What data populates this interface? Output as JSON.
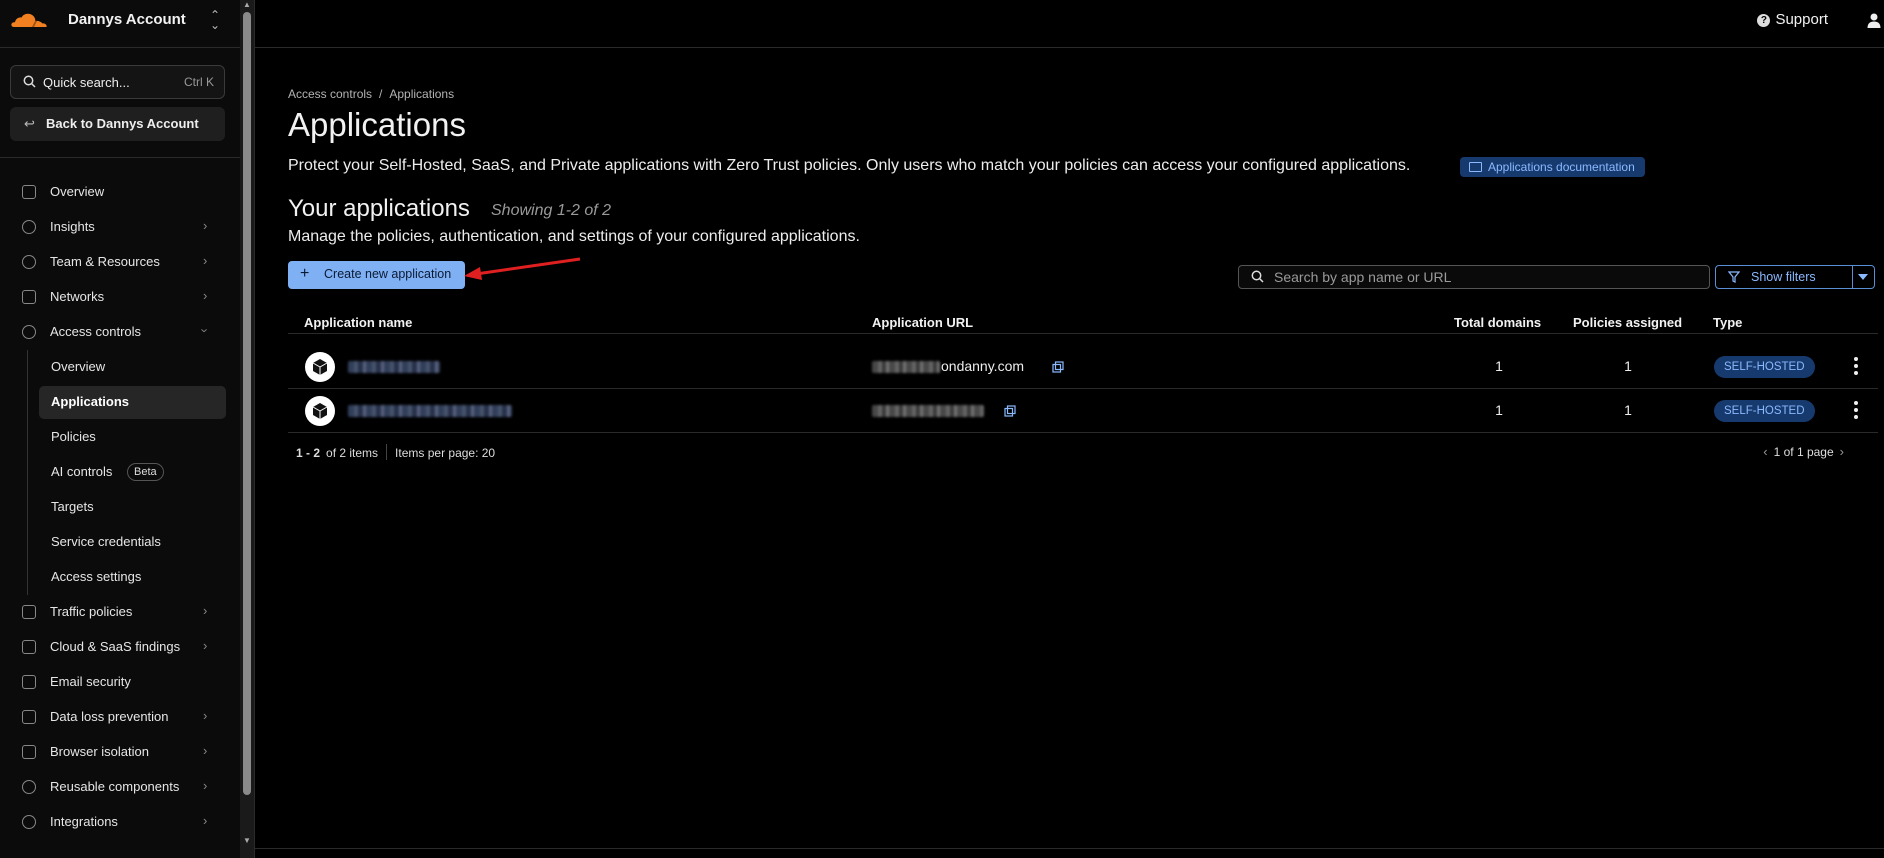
{
  "account": {
    "name": "Dannys Account"
  },
  "sidebar": {
    "quick_search": {
      "label": "Quick search...",
      "shortcut": "Ctrl K"
    },
    "back_button": "Back to Dannys Account",
    "items": [
      {
        "label": "Overview",
        "icon": "overview-icon",
        "has_chevron": false
      },
      {
        "label": "Insights",
        "icon": "insights-icon",
        "has_chevron": true
      },
      {
        "label": "Team & Resources",
        "icon": "team-icon",
        "has_chevron": true
      },
      {
        "label": "Networks",
        "icon": "networks-icon",
        "has_chevron": true
      },
      {
        "label": "Access controls",
        "icon": "access-controls-icon",
        "has_chevron": true,
        "expanded": true
      }
    ],
    "access_sub": [
      {
        "label": "Overview"
      },
      {
        "label": "Applications",
        "active": true
      },
      {
        "label": "Policies"
      },
      {
        "label": "AI controls",
        "badge": "Beta"
      },
      {
        "label": "Targets"
      },
      {
        "label": "Service credentials"
      },
      {
        "label": "Access settings"
      }
    ],
    "items_after": [
      {
        "label": "Traffic policies",
        "icon": "traffic-policies-icon",
        "has_chevron": true
      },
      {
        "label": "Cloud & SaaS findings",
        "icon": "cloud-findings-icon",
        "has_chevron": true
      },
      {
        "label": "Email security",
        "icon": "email-icon",
        "has_chevron": false
      },
      {
        "label": "Data loss prevention",
        "icon": "dlp-icon",
        "has_chevron": true
      },
      {
        "label": "Browser isolation",
        "icon": "browser-icon",
        "has_chevron": true
      },
      {
        "label": "Reusable components",
        "icon": "components-icon",
        "has_chevron": true
      },
      {
        "label": "Integrations",
        "icon": "integrations-icon",
        "has_chevron": true
      }
    ]
  },
  "topbar": {
    "support": "Support"
  },
  "breadcrumb": {
    "parent": "Access controls",
    "sep": "/",
    "current": "Applications"
  },
  "page": {
    "title": "Applications",
    "description": "Protect your Self-Hosted, SaaS, and Private applications with Zero Trust policies. Only users who match your policies can access your configured applications.",
    "doc_link": "Applications documentation",
    "section_title": "Your applications",
    "showing": "Showing 1-2 of 2",
    "section_desc": "Manage the policies, authentication, and settings of your configured applications.",
    "create_button": "Create new application",
    "search_placeholder": "Search by app name or URL",
    "filters_button": "Show filters"
  },
  "table": {
    "columns": [
      "Application name",
      "Application URL",
      "Total domains",
      "Policies assigned",
      "Type"
    ],
    "rows": [
      {
        "url_suffix": "ondanny.com",
        "total_domains": "1",
        "policies": "1",
        "type": "SELF-HOSTED"
      },
      {
        "url_suffix": "",
        "total_domains": "1",
        "policies": "1",
        "type": "SELF-HOSTED"
      }
    ]
  },
  "pager": {
    "range": "1 - 2",
    "of": "of 2 items",
    "per_page": "Items per page: 20",
    "page_info": "1 of 1 page"
  },
  "colors": {
    "accent": "#7fb0f4",
    "badge_bg": "#173a6e",
    "badge_fg": "#8ab9ff",
    "brand_orange": "#f38020",
    "annotation_arrow": "#e02020"
  }
}
